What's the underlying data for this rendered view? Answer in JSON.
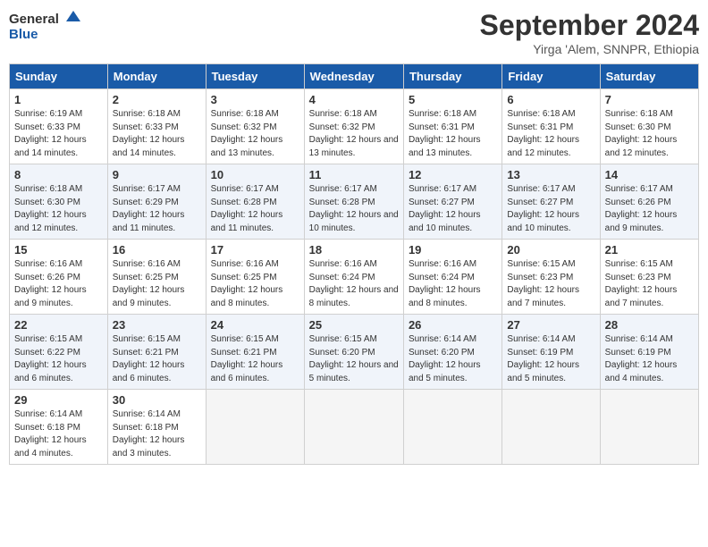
{
  "logo": {
    "line1": "General",
    "line2": "Blue"
  },
  "title": "September 2024",
  "subtitle": "Yirga 'Alem, SNNPR, Ethiopia",
  "days_of_week": [
    "Sunday",
    "Monday",
    "Tuesday",
    "Wednesday",
    "Thursday",
    "Friday",
    "Saturday"
  ],
  "weeks": [
    [
      {
        "day": 1,
        "sunrise": "6:19 AM",
        "sunset": "6:33 PM",
        "daylight": "12 hours and 14 minutes."
      },
      {
        "day": 2,
        "sunrise": "6:18 AM",
        "sunset": "6:33 PM",
        "daylight": "12 hours and 14 minutes."
      },
      {
        "day": 3,
        "sunrise": "6:18 AM",
        "sunset": "6:32 PM",
        "daylight": "12 hours and 13 minutes."
      },
      {
        "day": 4,
        "sunrise": "6:18 AM",
        "sunset": "6:32 PM",
        "daylight": "12 hours and 13 minutes."
      },
      {
        "day": 5,
        "sunrise": "6:18 AM",
        "sunset": "6:31 PM",
        "daylight": "12 hours and 13 minutes."
      },
      {
        "day": 6,
        "sunrise": "6:18 AM",
        "sunset": "6:31 PM",
        "daylight": "12 hours and 12 minutes."
      },
      {
        "day": 7,
        "sunrise": "6:18 AM",
        "sunset": "6:30 PM",
        "daylight": "12 hours and 12 minutes."
      }
    ],
    [
      {
        "day": 8,
        "sunrise": "6:18 AM",
        "sunset": "6:30 PM",
        "daylight": "12 hours and 12 minutes."
      },
      {
        "day": 9,
        "sunrise": "6:17 AM",
        "sunset": "6:29 PM",
        "daylight": "12 hours and 11 minutes."
      },
      {
        "day": 10,
        "sunrise": "6:17 AM",
        "sunset": "6:28 PM",
        "daylight": "12 hours and 11 minutes."
      },
      {
        "day": 11,
        "sunrise": "6:17 AM",
        "sunset": "6:28 PM",
        "daylight": "12 hours and 10 minutes."
      },
      {
        "day": 12,
        "sunrise": "6:17 AM",
        "sunset": "6:27 PM",
        "daylight": "12 hours and 10 minutes."
      },
      {
        "day": 13,
        "sunrise": "6:17 AM",
        "sunset": "6:27 PM",
        "daylight": "12 hours and 10 minutes."
      },
      {
        "day": 14,
        "sunrise": "6:17 AM",
        "sunset": "6:26 PM",
        "daylight": "12 hours and 9 minutes."
      }
    ],
    [
      {
        "day": 15,
        "sunrise": "6:16 AM",
        "sunset": "6:26 PM",
        "daylight": "12 hours and 9 minutes."
      },
      {
        "day": 16,
        "sunrise": "6:16 AM",
        "sunset": "6:25 PM",
        "daylight": "12 hours and 9 minutes."
      },
      {
        "day": 17,
        "sunrise": "6:16 AM",
        "sunset": "6:25 PM",
        "daylight": "12 hours and 8 minutes."
      },
      {
        "day": 18,
        "sunrise": "6:16 AM",
        "sunset": "6:24 PM",
        "daylight": "12 hours and 8 minutes."
      },
      {
        "day": 19,
        "sunrise": "6:16 AM",
        "sunset": "6:24 PM",
        "daylight": "12 hours and 8 minutes."
      },
      {
        "day": 20,
        "sunrise": "6:15 AM",
        "sunset": "6:23 PM",
        "daylight": "12 hours and 7 minutes."
      },
      {
        "day": 21,
        "sunrise": "6:15 AM",
        "sunset": "6:23 PM",
        "daylight": "12 hours and 7 minutes."
      }
    ],
    [
      {
        "day": 22,
        "sunrise": "6:15 AM",
        "sunset": "6:22 PM",
        "daylight": "12 hours and 6 minutes."
      },
      {
        "day": 23,
        "sunrise": "6:15 AM",
        "sunset": "6:21 PM",
        "daylight": "12 hours and 6 minutes."
      },
      {
        "day": 24,
        "sunrise": "6:15 AM",
        "sunset": "6:21 PM",
        "daylight": "12 hours and 6 minutes."
      },
      {
        "day": 25,
        "sunrise": "6:15 AM",
        "sunset": "6:20 PM",
        "daylight": "12 hours and 5 minutes."
      },
      {
        "day": 26,
        "sunrise": "6:14 AM",
        "sunset": "6:20 PM",
        "daylight": "12 hours and 5 minutes."
      },
      {
        "day": 27,
        "sunrise": "6:14 AM",
        "sunset": "6:19 PM",
        "daylight": "12 hours and 5 minutes."
      },
      {
        "day": 28,
        "sunrise": "6:14 AM",
        "sunset": "6:19 PM",
        "daylight": "12 hours and 4 minutes."
      }
    ],
    [
      {
        "day": 29,
        "sunrise": "6:14 AM",
        "sunset": "6:18 PM",
        "daylight": "12 hours and 4 minutes."
      },
      {
        "day": 30,
        "sunrise": "6:14 AM",
        "sunset": "6:18 PM",
        "daylight": "12 hours and 3 minutes."
      },
      null,
      null,
      null,
      null,
      null
    ]
  ]
}
